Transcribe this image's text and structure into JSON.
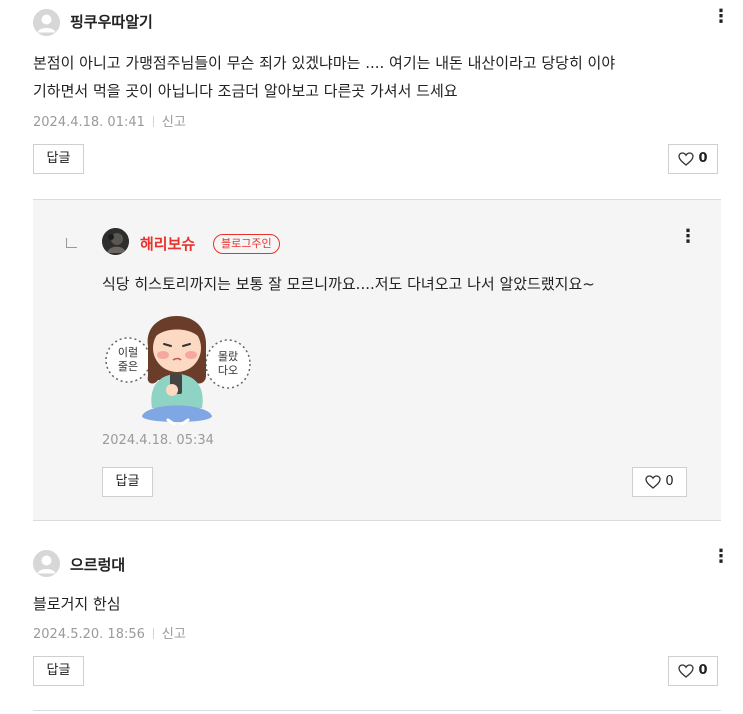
{
  "comments": [
    {
      "author": "핑쿠우따알기",
      "text_line1": "본점이 아니고 가맹점주님들이 무슨 죄가 있겠냐마는 .... 여기는 내돈 내산이라고 당당히 이야",
      "text_line2": "기하면서 먹을 곳이 아닙니다 조금더 알아보고 다른곳 가셔서 드세요",
      "date": "2024.4.18. 01:41",
      "report_label": "신고",
      "reply_label": "답글",
      "like_count": "0"
    },
    {
      "author": "해리보슈",
      "badge": "블로그주인",
      "text": "식당 히스토리까지는 보통 잘 모르니까요....저도 다녀오고 나서 알았드랬지요~",
      "sticker_text_left": "이럴 줄은",
      "sticker_text_right": "몰랐 다오",
      "date": "2024.4.18. 05:34",
      "reply_label": "답글",
      "like_count": "0"
    },
    {
      "author": "으르렁대",
      "text": "블로거지 한심",
      "date": "2024.5.20. 18:56",
      "report_label": "신고",
      "reply_label": "답글",
      "like_count": "0"
    }
  ],
  "icons": {
    "more": "more-vertical-icon",
    "like": "heart-outline-icon",
    "default_avatar": "default-profile-icon",
    "reply_indent": "reply-corner-icon"
  },
  "colors": {
    "owner_accent": "#e8322b",
    "reply_background": "#f5f5f5",
    "meta_text": "#9a9a9a"
  }
}
